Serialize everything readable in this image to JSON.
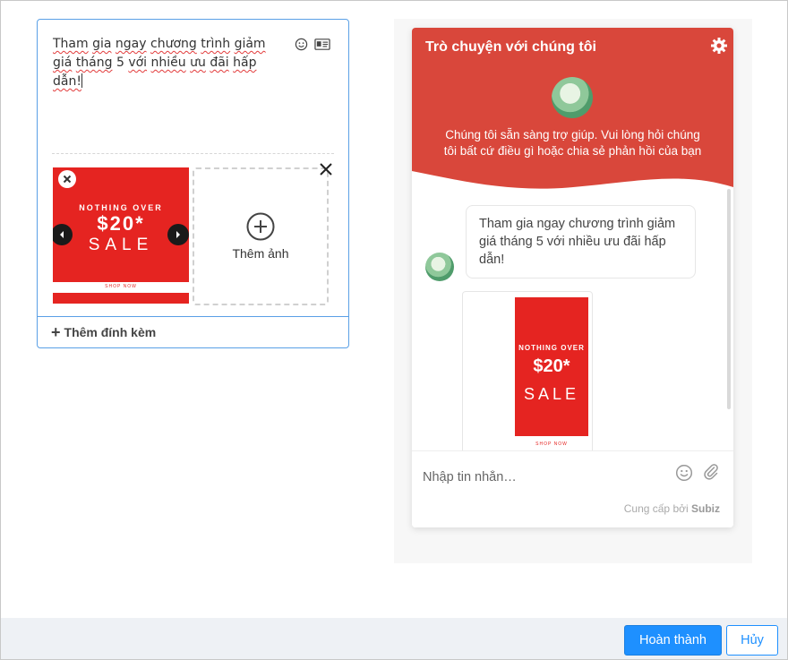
{
  "composer": {
    "message_parts": [
      {
        "text": "Tham",
        "squiggle": true
      },
      {
        "text": " ",
        "squiggle": false
      },
      {
        "text": "gia",
        "squiggle": true
      },
      {
        "text": " ",
        "squiggle": false
      },
      {
        "text": "ngay",
        "squiggle": true
      },
      {
        "text": " ",
        "squiggle": false
      },
      {
        "text": "chương",
        "squiggle": true
      },
      {
        "text": " ",
        "squiggle": false
      },
      {
        "text": "trình",
        "squiggle": true
      },
      {
        "text": " ",
        "squiggle": false
      },
      {
        "text": "giảm",
        "squiggle": true
      },
      {
        "text": " ",
        "squiggle": false
      },
      {
        "text": "giá",
        "squiggle": true
      },
      {
        "text": " ",
        "squiggle": false
      },
      {
        "text": "tháng",
        "squiggle": true
      },
      {
        "text": " 5 ",
        "squiggle": false
      },
      {
        "text": "với",
        "squiggle": true
      },
      {
        "text": " ",
        "squiggle": false
      },
      {
        "text": "nhiều",
        "squiggle": true
      },
      {
        "text": " ",
        "squiggle": false
      },
      {
        "text": "ưu",
        "squiggle": true
      },
      {
        "text": " ",
        "squiggle": false
      },
      {
        "text": "đãi",
        "squiggle": true
      },
      {
        "text": " ",
        "squiggle": false
      },
      {
        "text": "hấp",
        "squiggle": true
      },
      {
        "text": " ",
        "squiggle": false
      },
      {
        "text": "dẫn!",
        "squiggle": true
      }
    ],
    "icons": [
      "smile-icon",
      "contact-card-icon"
    ],
    "thumbnail": {
      "line1": "NOTHING OVER",
      "line2": "$20*",
      "line3": "SALE",
      "line4": "SHOP NOW",
      "background": "#e52421"
    },
    "add_photo_label": "Thêm ảnh",
    "attach_label": "Thêm đính kèm",
    "border_color": "#5aa0e6"
  },
  "widget": {
    "title": "Trò chuyện với chúng tôi",
    "subtitle_line1": "Chúng tôi sẵn sàng trợ giúp. Vui lòng hỏi chúng",
    "subtitle_line2": "tôi bất cứ điều gì hoặc chia sẻ phản hồi của bạn",
    "header_color": "#d9473b",
    "message": "Tham gia ngay chương trình giảm giá tháng 5 với nhiều ưu đãi hấp dẫn!",
    "image_message": {
      "line1": "NOTHING OVER",
      "line2": "$20*",
      "line3": "SALE",
      "line4": "SHOP NOW"
    },
    "input_placeholder": "Nhập tin nhắn…",
    "powered_prefix": "Cung cấp bởi",
    "powered_brand": "Subiz"
  },
  "footer": {
    "done_label": "Hoàn thành",
    "cancel_label": "Hủy",
    "primary_color": "#1e90ff"
  }
}
